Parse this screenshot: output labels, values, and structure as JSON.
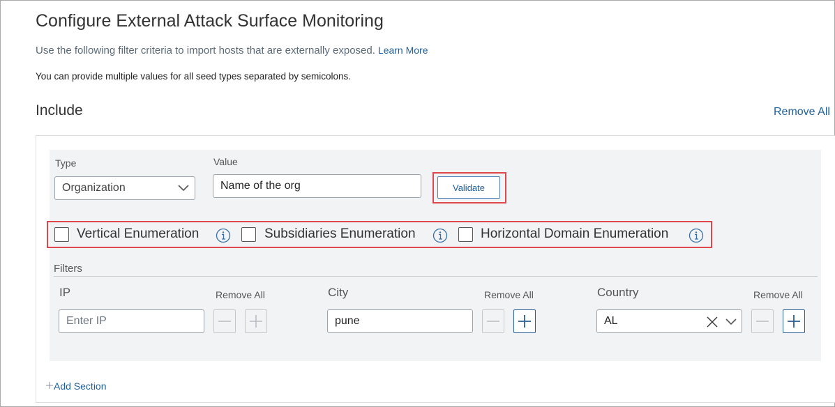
{
  "header": {
    "title": "Configure External Attack Surface Monitoring",
    "subtitle": "Use the following filter criteria to import hosts that are externally exposed.",
    "learn_more": "Learn More",
    "hint": "You can provide multiple values for all seed types separated by semicolons."
  },
  "include": {
    "title": "Include",
    "remove_all": "Remove All",
    "type_label": "Type",
    "type_value": "Organization",
    "value_label": "Value",
    "value_text": "Name of the org",
    "validate_label": "Validate",
    "checkboxes": [
      {
        "label": "Vertical Enumeration",
        "checked": false
      },
      {
        "label": "Subsidiaries Enumeration",
        "checked": false
      },
      {
        "label": "Horizontal Domain Enumeration",
        "checked": false
      }
    ],
    "filters_label": "Filters",
    "filters": [
      {
        "label": "IP",
        "remove_all": "Remove All",
        "placeholder": "Enter IP",
        "value": ""
      },
      {
        "label": "City",
        "remove_all": "Remove All",
        "placeholder": "",
        "value": "pune"
      },
      {
        "label": "Country",
        "remove_all": "Remove All",
        "placeholder": "",
        "value": "AL"
      }
    ],
    "add_section": "Add Section"
  },
  "icons": {
    "dropdown": "chevron-down-icon",
    "info": "info-icon",
    "minus": "minus-icon",
    "plus": "plus-icon",
    "clear": "close-icon"
  },
  "colors": {
    "link": "#1e5f9e",
    "highlight": "#e0474c",
    "panel": "#f1f3f5"
  }
}
